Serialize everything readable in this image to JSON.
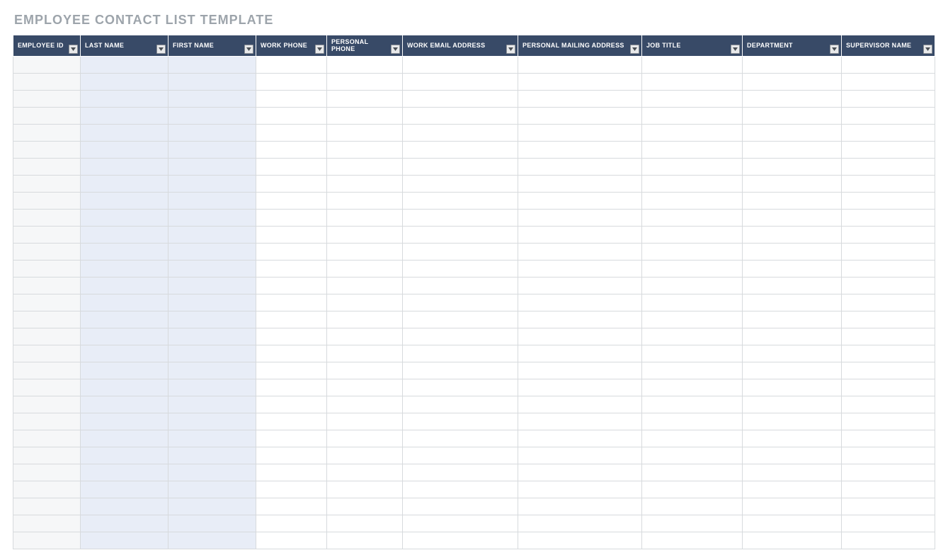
{
  "title": "EMPLOYEE CONTACT LIST TEMPLATE",
  "columns": [
    {
      "key": "employee_id",
      "label": "EMPLOYEE ID"
    },
    {
      "key": "last_name",
      "label": "LAST NAME"
    },
    {
      "key": "first_name",
      "label": "FIRST NAME"
    },
    {
      "key": "work_phone",
      "label": "WORK PHONE"
    },
    {
      "key": "personal_phone",
      "label": "PERSONAL PHONE"
    },
    {
      "key": "work_email",
      "label": "WORK EMAIL ADDRESS"
    },
    {
      "key": "personal_mailing_address",
      "label": "PERSONAL MAILING ADDRESS"
    },
    {
      "key": "job_title",
      "label": "JOB TITLE"
    },
    {
      "key": "department",
      "label": "DEPARTMENT"
    },
    {
      "key": "supervisor_name",
      "label": "SUPERVISOR NAME"
    }
  ],
  "shaded_column_keys": [
    "employee_id",
    "last_name",
    "first_name"
  ],
  "shaded_column_colors": {
    "employee_id": "alt-a",
    "last_name": "alt-b",
    "first_name": "alt-b"
  },
  "row_count": 29,
  "rows": []
}
